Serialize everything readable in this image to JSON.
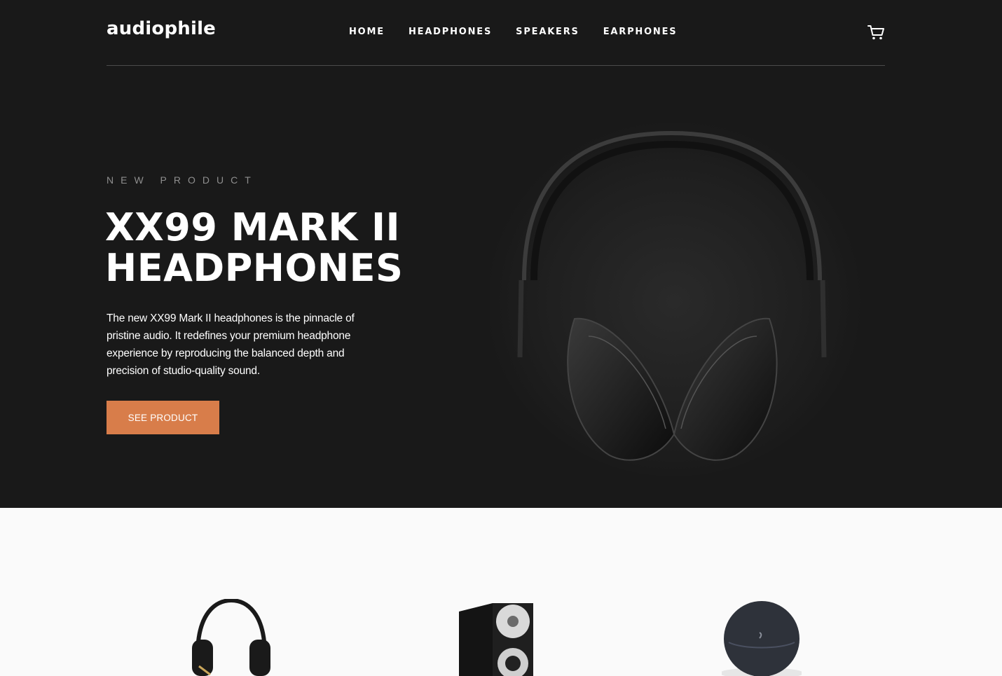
{
  "brand": {
    "logo": "audiophile"
  },
  "nav": {
    "links": [
      "HOME",
      "HEADPHONES",
      "SPEAKERS",
      "EARPHONES"
    ],
    "cart_icon": "cart-icon"
  },
  "hero": {
    "eyebrow": "NEW PRODUCT",
    "title_line1": "XX99 MARK II",
    "title_line2": "HEADPHONES",
    "description": "The new XX99 Mark II headphones is the pinnacle of pristine audio. It redefines your premium headphone experience by reproducing the balanced depth and precision of studio-quality sound.",
    "cta": "SEE PRODUCT",
    "image": "headphones-hero-image"
  },
  "categories": {
    "images": [
      "headphones-thumbnail",
      "speaker-thumbnail",
      "earphones-thumbnail"
    ]
  },
  "colors": {
    "hero_bg": "#191919",
    "accent": "#D87D4A",
    "page_bg": "#FAFAFA",
    "muted_text": "#8E8E8E"
  }
}
